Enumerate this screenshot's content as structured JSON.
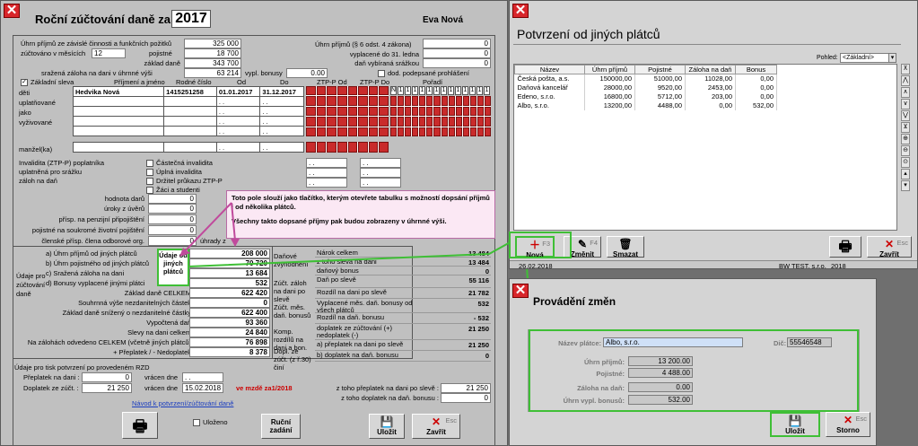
{
  "main": {
    "title": "Roční zúčtování daně za :",
    "year": "2017",
    "person_name": "Eva  Nová",
    "uhrn_prijmu_label": "Úhrn příjmů ze závislé činnosti a funkčních požitků",
    "uhrn_prijmu": "325 000",
    "zuctovano_label": "zúčtováno v měsících",
    "mesicu": "12",
    "pojistne_label": "pojistné",
    "pojistne": "18 700",
    "zaklad_dane_label": "základ daně",
    "zaklad_dane": "343 700",
    "srazena_zaloha_label": "sražená záloha na dani v úhrnné výši",
    "srazena_zaloha": "63 214",
    "vypl_bonusy_label": "vypl. bonusy",
    "vypl_bonusy": "0.00",
    "uhrn_paragraf6_label": "Úhrn příjmů (§ 6 odst. 4 zákona)",
    "uhrn_paragraf6": "0",
    "vyplacene_label": "vyplacené do 31. ledna",
    "vyplacene": "0",
    "vybirana_srazkou_label": "daň vybíraná srážkou",
    "vybirana_srazkou": "0",
    "dod_prohlaseni_label": "dod. podepsané prohlášení",
    "zakladni_sleva_label": "Základní sleva",
    "child_headers": [
      "Příjmení a jméno",
      "Rodné číslo",
      "Od",
      "Do",
      "ZTP-P Od",
      "ZTP-P Do",
      "Pořadí"
    ],
    "deti_label": "děti\nuplatňované\njako\nvyživované",
    "children": [
      {
        "name": "Hedvika Nová",
        "rc": "1415251258",
        "od": "01.01.2017",
        "do": "31.12.2017"
      },
      {
        "name": "",
        "rc": "",
        "od": ". .",
        "do": ". ."
      },
      {
        "name": "",
        "rc": "",
        "od": ". .",
        "do": ". ."
      },
      {
        "name": "",
        "rc": "",
        "od": ". .",
        "do": ". ."
      },
      {
        "name": "",
        "rc": "",
        "od": ". .",
        "do": ". ."
      }
    ],
    "n_label": "N",
    "manzel_label": "manžel(ka)",
    "invalidita_label": "Invalidita (ZTP-P) poplatníka\nuplatněná pro srážku\nzáloh na daň",
    "invalidita_opts": [
      "Částečná invalidita",
      "Úplná invalidita",
      "Držitel průkazu ZTP-P",
      "Žáci a studenti"
    ],
    "hodnota_daru_label": "hodnota darů",
    "hodnota_daru": "0",
    "uroky_label": "úroky z úvěrů",
    "uroky": "0",
    "prisp_penz_label": "přísp. na penzijní připojištění",
    "prisp_penz": "0",
    "pojistne_soukr_label": "pojistné na soukromé životní pojištění",
    "pojistne_soukr": "0",
    "clenske_label": "členské přísp. člena odborové org.",
    "clenske": "0",
    "uhrady_label": "úhrady z",
    "udaje_label": "Údaje pro\nzúčtování\ndaně",
    "left_rows": [
      {
        "label": "a) Úhrn příjmů od jiných plátců",
        "value": "208 000"
      },
      {
        "label": "b) Úhrn pojistného od jiných plátců",
        "value": "70 720"
      },
      {
        "label": "c) Sražená záloha na dani",
        "value": "13 684"
      },
      {
        "label": "d) Bonusy vyplacené jinými plátci",
        "value": "532"
      },
      {
        "label": "Základ daně CELKEM",
        "value": "622 420"
      },
      {
        "label": "Souhrnná výše nezdanitelných částek",
        "value": "0"
      },
      {
        "label": "Základ daně snížený o nezdanitelné částky",
        "value": "622 400"
      },
      {
        "label": "Vypočtená daň",
        "value": "93 360"
      },
      {
        "label": "Slevy na dani celkem",
        "value": "24 840"
      },
      {
        "label": "Na zálohách odvedeno CELKEM (včetně jiných plátců)",
        "value": "76 898"
      },
      {
        "label": "+ Přeplatek / - Nedoplatek",
        "value": "8 378"
      }
    ],
    "udaje_btn": "Údaje od jiných plátců",
    "dan_label": "Daňové zvýhodnění",
    "dan_rows": [
      {
        "label": "Nárok celkem",
        "value": "13 484"
      },
      {
        "label": "z toho sleva na dani",
        "value": "13 484"
      },
      {
        "label": "daňový bonus",
        "value": "0"
      }
    ],
    "zuct_label": "Zúčt. záloh na dani po slevě",
    "zuct_rows": [
      {
        "label": "Daň po slevě",
        "value": "55 116"
      },
      {
        "label": "Rozdíl na dani po slevě",
        "value": "21 782"
      }
    ],
    "zuct_bon_label": "Zúčt. měs. daň. bonusů",
    "zuct_bon_rows": [
      {
        "label": "Vyplacené měs. daň. bonusy od všech plátců",
        "value": "532"
      },
      {
        "label": "Rozdíl na daň. bonusu",
        "value": "- 532"
      }
    ],
    "komp_label": "Komp. rozdílů na dani a bon.",
    "komp_row": {
      "label": "doplatek ze zúčtování (+) nedoplatek (-)",
      "value": "21 250"
    },
    "dopl_label": "Dopl. ze zúčt. (z ř.30) činí",
    "dopl_rows": [
      {
        "label": "a) přeplatek na dani po slevě",
        "value": "21 250"
      },
      {
        "label": "b) doplatek na daň. bonusu",
        "value": "0"
      }
    ],
    "tisk_label": "Údaje pro tisk potvrzení po provedeném RZD",
    "preplatek_label": "Přeplatek na dani :",
    "preplatek": "0",
    "vracen_label": "vrácen dne",
    "vracen_dne": ". .",
    "doplatek_label": "Doplatek ze zúčt. :",
    "doplatek": "21 250",
    "vracen_dne2": "15.02.2018",
    "mzde_label": "ve mzdě za1/2018",
    "ztoho_prep_label": "z toho přeplatek na dani po slevě :",
    "ztoho_prep": "21 250",
    "ztoho_dopl_label": "z toho doplatek na daň. bonusu :",
    "ztoho_dopl": "0",
    "navod_link": "Návod k potvrzení/zúčtování daně",
    "ulozeno_label": "Uloženo",
    "rucni_btn": "Ruční zadání",
    "ulozit_btn": "Uložit",
    "zavrit_btn": "Zavřít",
    "esc_key": "Esc"
  },
  "tooltip": {
    "line1": "Toto pole slouží jako tlačítko, kterým otevřete tabulku s možností dopsání příjmů i od několika plátců.",
    "line2": "Všechny takto dopsané příjmy pak budou zobrazeny v úhrnné výši."
  },
  "potvrzeni": {
    "title": "Potvrzení od jiných plátců",
    "pohled_label": "Pohled:",
    "pohled_value": "<Základní>",
    "columns": [
      "Název",
      "Úhrn příjmů",
      "Pojistné",
      "Záloha na daň",
      "Bonus"
    ],
    "rows": [
      [
        "Česká pošta, a.s.",
        "150000,00",
        "51000,00",
        "11028,00",
        "0,00"
      ],
      [
        "Daňová kancelář",
        "28000,00",
        "9520,00",
        "2453,00",
        "0,00"
      ],
      [
        "Edeno, s.r.o.",
        "16800,00",
        "5712,00",
        "203,00",
        "0,00"
      ],
      [
        "Albo, s.r.o.",
        "13200,00",
        "4488,00",
        "0,00",
        "532,00"
      ]
    ],
    "nova_btn": "Nová",
    "nova_key": "F3",
    "zmenit_btn": "Změnit",
    "zmenit_key": "F4",
    "smazat_btn": "Smazat",
    "zavrit_btn": "Zavřít",
    "esc_key": "Esc",
    "status_date": "26.02.2018",
    "status_company": "BW TEST, s.r.o.",
    "status_year": "2018"
  },
  "provadeni": {
    "title": "Provádění změn",
    "nazev_label": "Název plátce:",
    "nazev": "Albo, s.r.o.",
    "dic_label": "Dič:",
    "dic": "55546548",
    "uhrn_label": "Úhrn příjmů:",
    "uhrn": "13 200.00",
    "pojistne_label": "Pojistné:",
    "pojistne": "4 488.00",
    "zaloha_label": "Záloha na daň:",
    "zaloha": "0.00",
    "bonus_label": "Úhrn vypl. bonusů:",
    "bonus": "532.00",
    "ulozit_btn": "Uložit",
    "storno_btn": "Storno",
    "esc_key": "Esc"
  }
}
